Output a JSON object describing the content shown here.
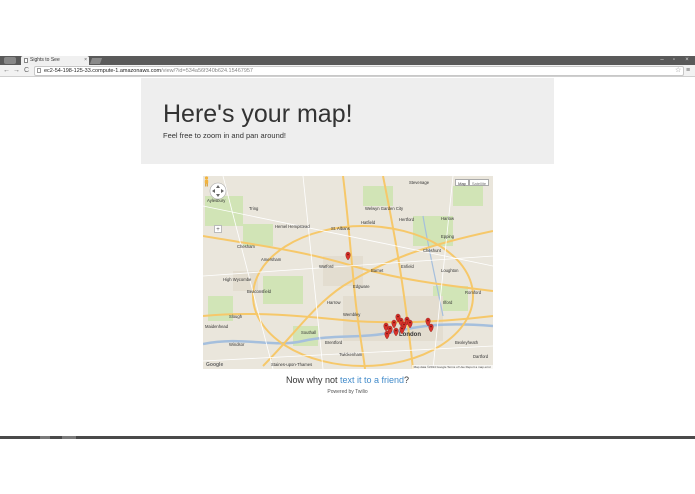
{
  "browser": {
    "tab_title": "Sights to See",
    "tab_close": "×",
    "url_host": "ec2-54-198-125-33.compute-1.amazonaws.com",
    "url_path": "/view/?id=534a56f340b624.15467957",
    "window_controls": [
      "–",
      "▫",
      "×"
    ],
    "nav": {
      "back": "←",
      "forward": "→",
      "reload": "C"
    },
    "star": "☆",
    "menu": "≡"
  },
  "header": {
    "title": "Here's your map!",
    "subtitle": "Feel free to zoom in and pan around!"
  },
  "map": {
    "type_map": "Map",
    "type_satellite": "Satellite",
    "zoom_in": "+",
    "logo": "Google",
    "attribution": "Map data ©2014 Google  Terms of Use  Report a map error",
    "labels": [
      "Aylesbury",
      "Tring",
      "Hemel Hempstead",
      "St. Albans",
      "Hatfield",
      "Hertford",
      "Harlow",
      "Chesham",
      "Amersham",
      "Watford",
      "Barnet",
      "Enfield",
      "Cheshunt",
      "High Wycombe",
      "Beaconsfield",
      "Edgware",
      "Slough",
      "Maidenhead",
      "Wembley",
      "London",
      "Southall",
      "Brentford",
      "Twickenham",
      "Romford",
      "Ilford",
      "Dartford",
      "Bexleyheath",
      "Windsor",
      "Staines-upon-Thames",
      "Stevenage",
      "Welwyn Garden City",
      "Epping",
      "Loughton",
      "Harrow"
    ],
    "pin_count": 14,
    "pin_color": "#d9322b"
  },
  "cta": {
    "prefix": "Now why not ",
    "link": "text it to a friend",
    "suffix": "?"
  },
  "footer": {
    "powered": "Powered by Twilio"
  },
  "colors": {
    "jumbotron": "#eeeeee",
    "link": "#428bca",
    "map_bg": "#eae6dc",
    "road_major": "#f6c86a",
    "water": "#a5bfdd",
    "park": "#cde4b0"
  }
}
